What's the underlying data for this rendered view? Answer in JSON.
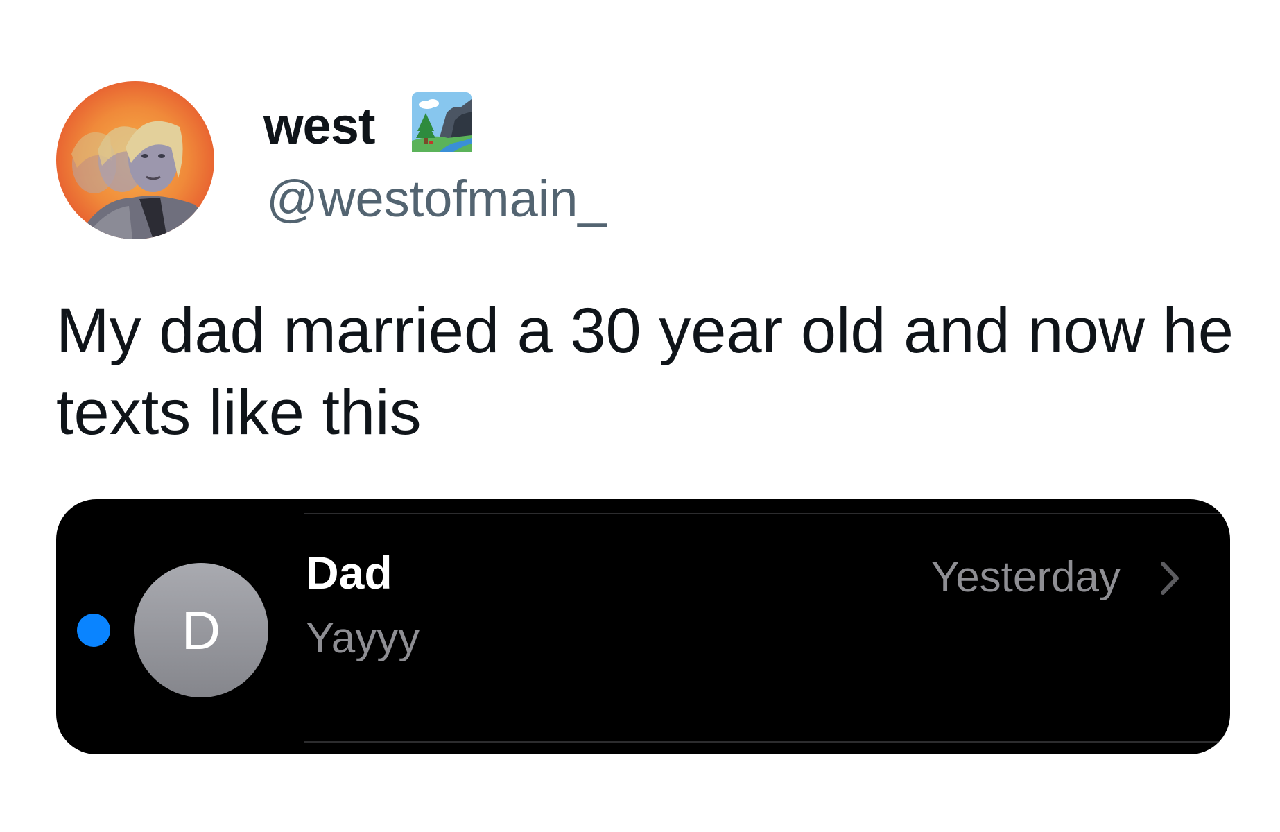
{
  "tweet": {
    "author": {
      "display_name": "west",
      "name_emoji": "national-park-emoji",
      "handle": "@westofmain_",
      "avatar": "profile-photo"
    },
    "text": "My dad married a 30 year old and now he texts like this"
  },
  "message_card": {
    "unread": true,
    "unread_color": "#0a84ff",
    "contact_initial": "D",
    "contact_name": "Dad",
    "preview": "Yayyy",
    "timestamp": "Yesterday",
    "disclosure_icon": "chevron-right-icon",
    "background": "#000000"
  }
}
